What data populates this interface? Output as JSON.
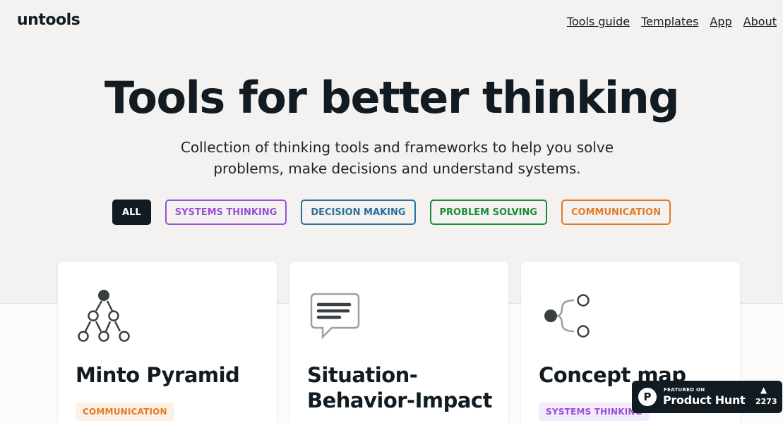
{
  "header": {
    "logo": "untools",
    "nav": [
      "Tools guide",
      "Templates",
      "App",
      "About"
    ]
  },
  "hero": {
    "title": "Tools for better thinking",
    "subtitle": "Collection of thinking tools and frameworks to help you solve problems, make decisions and understand systems."
  },
  "filters": [
    {
      "label": "ALL",
      "color": "#111b21",
      "active": true
    },
    {
      "label": "SYSTEMS THINKING",
      "color": "#9a4fd6"
    },
    {
      "label": "DECISION MAKING",
      "color": "#2b6f9b"
    },
    {
      "label": "PROBLEM SOLVING",
      "color": "#1f8a3a"
    },
    {
      "label": "COMMUNICATION",
      "color": "#e07b28"
    }
  ],
  "cards": [
    {
      "title": "Minto Pyramid",
      "tag": "COMMUNICATION",
      "icon": "pyramid-tree-icon"
    },
    {
      "title": "Situation-Behavior-Impact",
      "tag": "",
      "icon": "speech-bubble-icon"
    },
    {
      "title": "Concept map",
      "tag": "SYSTEMS THINKING",
      "icon": "branching-nodes-icon"
    }
  ],
  "product_hunt": {
    "featured": "FEATURED ON",
    "name": "Product Hunt",
    "count": "2273",
    "icon": "product-hunt-logo-icon"
  }
}
